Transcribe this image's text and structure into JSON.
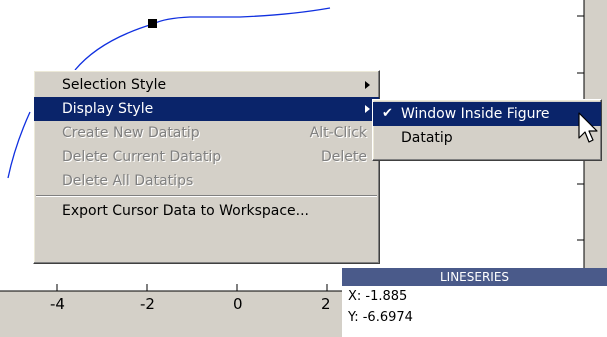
{
  "axes": {
    "x_tick_labels": [
      "-4",
      "-2",
      "0",
      "2"
    ],
    "colors": {
      "line": "#1030e0",
      "figure_bg": "#d4d0c8",
      "axes_bg": "#ffffff"
    }
  },
  "context_menu": {
    "items": [
      {
        "label": "Selection Style",
        "submenu": true,
        "enabled": true,
        "selected": false
      },
      {
        "label": "Display Style",
        "submenu": true,
        "enabled": true,
        "selected": true
      },
      {
        "label": "Create New Datatip",
        "shortcut": "Alt-Click",
        "enabled": false
      },
      {
        "label": "Delete Current Datatip",
        "shortcut": "Delete",
        "enabled": false
      },
      {
        "label": "Delete All Datatips",
        "enabled": false
      },
      {
        "label": "Export Cursor Data to Workspace...",
        "enabled": true
      }
    ]
  },
  "submenu": {
    "items": [
      {
        "label": "Window Inside Figure",
        "checked": true,
        "selected": true
      },
      {
        "label": "Datatip",
        "checked": false,
        "selected": false
      }
    ]
  },
  "datatip_window": {
    "header": "LINESERIES",
    "x_line": "X: -1.885",
    "y_line": "Y: -6.6974"
  }
}
